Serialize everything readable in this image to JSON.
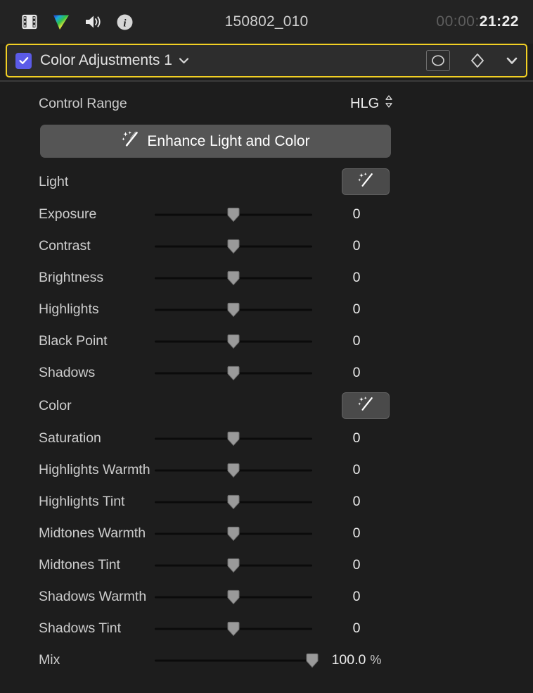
{
  "toolbar": {
    "icons": [
      {
        "name": "film-strip-icon",
        "label": "Video"
      },
      {
        "name": "color-inspector-icon",
        "label": "Color"
      },
      {
        "name": "audio-speaker-icon",
        "label": "Audio"
      },
      {
        "name": "info-icon",
        "label": "Info"
      }
    ],
    "title": "150802_010",
    "timecode_dim": "00:00:",
    "timecode_bright": "21:22"
  },
  "effect_header": {
    "checkbox_checked": true,
    "name": "Color Adjustments 1",
    "popup_icon": "chevron-down-icon",
    "mask_icon": "shape-mask-icon",
    "keyframe_icon": "keyframe-diamond-icon",
    "collapse_icon": "chevron-down-icon",
    "accent_color": "#f2d024",
    "checkbox_color": "#5b5be8"
  },
  "control_range": {
    "label": "Control Range",
    "value": "HLG",
    "stepper_icon": "stepper-up-down-icon"
  },
  "enhance_button": {
    "label": "Enhance Light and Color",
    "icon": "magic-wand-icon"
  },
  "sections": [
    {
      "title": "Light",
      "auto_button_icon": "magic-wand-icon",
      "params": [
        {
          "label": "Exposure",
          "value": "0",
          "unit": "",
          "knob_pct": 50
        },
        {
          "label": "Contrast",
          "value": "0",
          "unit": "",
          "knob_pct": 50
        },
        {
          "label": "Brightness",
          "value": "0",
          "unit": "",
          "knob_pct": 50
        },
        {
          "label": "Highlights",
          "value": "0",
          "unit": "",
          "knob_pct": 50
        },
        {
          "label": "Black Point",
          "value": "0",
          "unit": "",
          "knob_pct": 50
        },
        {
          "label": "Shadows",
          "value": "0",
          "unit": "",
          "knob_pct": 50
        }
      ]
    },
    {
      "title": "Color",
      "auto_button_icon": "magic-wand-icon",
      "params": [
        {
          "label": "Saturation",
          "value": "0",
          "unit": "",
          "knob_pct": 50
        },
        {
          "label": "Highlights Warmth",
          "value": "0",
          "unit": "",
          "knob_pct": 50
        },
        {
          "label": "Highlights Tint",
          "value": "0",
          "unit": "",
          "knob_pct": 50
        },
        {
          "label": "Midtones Warmth",
          "value": "0",
          "unit": "",
          "knob_pct": 50
        },
        {
          "label": "Midtones Tint",
          "value": "0",
          "unit": "",
          "knob_pct": 50
        },
        {
          "label": "Shadows Warmth",
          "value": "0",
          "unit": "",
          "knob_pct": 50
        },
        {
          "label": "Shadows Tint",
          "value": "0",
          "unit": "",
          "knob_pct": 50
        }
      ]
    }
  ],
  "mix": {
    "label": "Mix",
    "value": "100.0",
    "unit": "%",
    "knob_pct": 100
  }
}
